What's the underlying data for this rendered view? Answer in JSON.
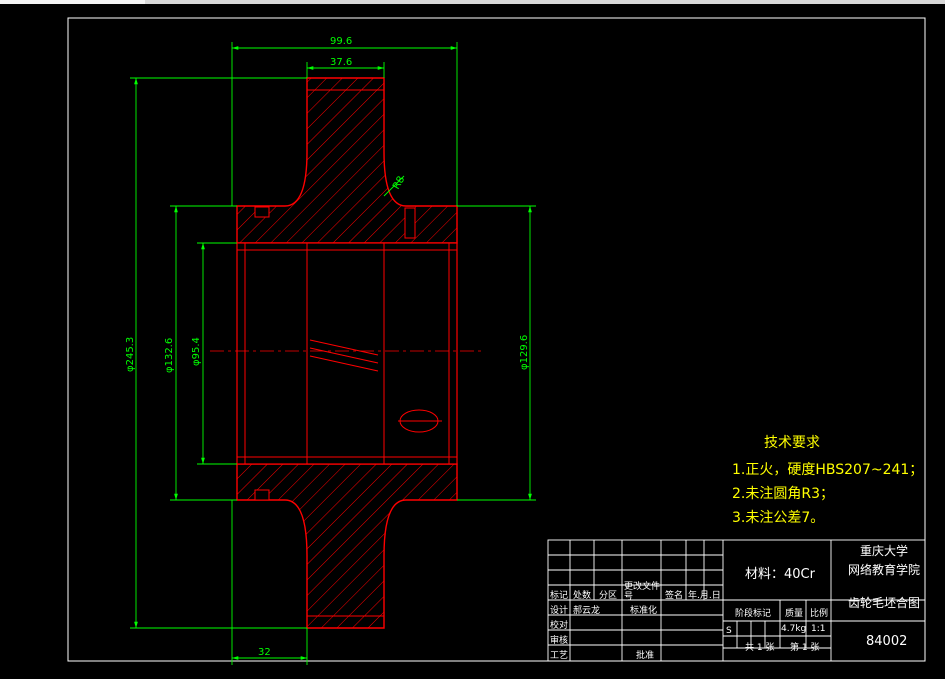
{
  "dimensions": {
    "overall_width": "99.6",
    "hub_width": "37.6",
    "bore_len": "32",
    "dia_outer": "φ245.3",
    "dia_hub": "φ132.6",
    "dia_bore": "φ95.4",
    "dia_hub_right": "φ129.6",
    "fillet": "R8"
  },
  "tech_requirements": {
    "title": "技术要求",
    "items": [
      "1.正火，硬度HBS207~241；",
      "2.未注圆角R3；",
      "3.未注公差7。"
    ]
  },
  "title_block": {
    "material": "材料：40Cr",
    "school_line1": "重庆大学",
    "school_line2": "网络教育学院",
    "drawing_name": "齿轮毛坯合图",
    "drawing_number": "84002",
    "mass_value": "4.7kg",
    "scale_value": "1:1",
    "stage_mark": "S",
    "col_headers": [
      "标记",
      "处数",
      "分区",
      "更改文件号",
      "签名",
      "年.月.日"
    ],
    "row_labels": [
      "设计",
      "校对",
      "审核",
      "工艺"
    ],
    "designer": "郝云龙",
    "standardization": "标准化",
    "approval": "批准",
    "stage_label": "阶段标记",
    "mass_label": "质量",
    "scale_label": "比例",
    "sheets_total": "共 1 张",
    "sheet_no": "第 1 张"
  },
  "colors": {
    "background": "#000000",
    "section_outline": "#ff0000",
    "dimension": "#00ff00",
    "annotation": "#ffff00",
    "frame": "#ffffff"
  }
}
